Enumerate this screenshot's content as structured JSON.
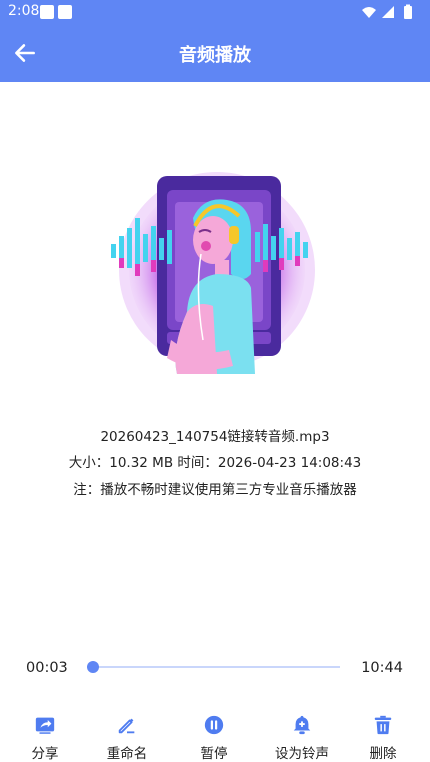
{
  "status_bar": {
    "time": "2:08"
  },
  "app_bar": {
    "title": "音频播放"
  },
  "file": {
    "name": "20260423_140754链接转音频.mp3",
    "size_time": "大小：10.32 MB  时间：2026-04-23 14:08:43",
    "note": "注：播放不畅时建议使用第三方专业音乐播放器"
  },
  "player": {
    "position": "00:03",
    "duration": "10:44",
    "progress_fraction": 0.005
  },
  "actions": [
    {
      "label": "分享",
      "icon": "share-icon"
    },
    {
      "label": "重命名",
      "icon": "edit-icon"
    },
    {
      "label": "暂停",
      "icon": "pause-icon"
    },
    {
      "label": "设为铃声",
      "icon": "bell-plus-icon"
    },
    {
      "label": "删除",
      "icon": "trash-icon"
    }
  ],
  "colors": {
    "primary": "#5f86f4",
    "icon_blue": "#4f7cf0",
    "track": "#c9d6fb"
  }
}
